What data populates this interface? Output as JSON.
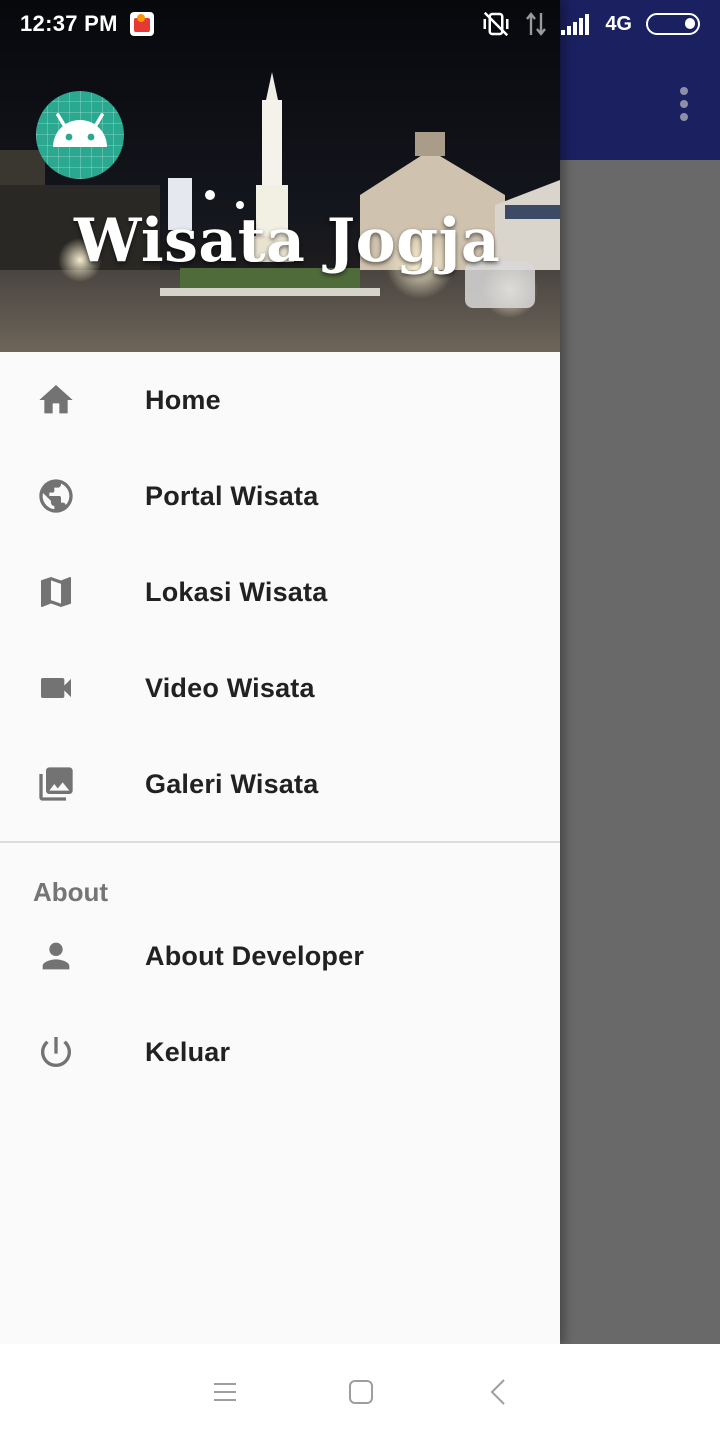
{
  "status_bar": {
    "time": "12:37 PM",
    "network": "4G",
    "icons": [
      "app-notification-icon",
      "vibrate-off-icon",
      "data-arrows-icon",
      "signal-icon",
      "battery-icon"
    ]
  },
  "app_bar": {
    "overflow_icon": "more-vert-icon"
  },
  "drawer": {
    "header": {
      "title": "Wisata Jogja",
      "avatar_icon": "android-icon"
    },
    "menu": [
      {
        "label": "Home",
        "icon": "home-icon"
      },
      {
        "label": "Portal Wisata",
        "icon": "globe-icon"
      },
      {
        "label": "Lokasi Wisata",
        "icon": "map-icon"
      },
      {
        "label": "Video Wisata",
        "icon": "videocam-icon"
      },
      {
        "label": "Galeri Wisata",
        "icon": "photo-library-icon"
      }
    ],
    "about_section": {
      "header": "About",
      "items": [
        {
          "label": "About Developer",
          "icon": "person-icon"
        },
        {
          "label": "Keluar",
          "icon": "power-icon"
        }
      ]
    }
  },
  "nav_bar": {
    "icons": [
      "menu-icon",
      "home-square-icon",
      "back-icon"
    ]
  },
  "colors": {
    "toolbar": "#1b2060",
    "scrim_content": "#696969",
    "drawer_bg": "#fafafa",
    "icon_grey": "#737373",
    "avatar_bg": "#2aa890"
  }
}
